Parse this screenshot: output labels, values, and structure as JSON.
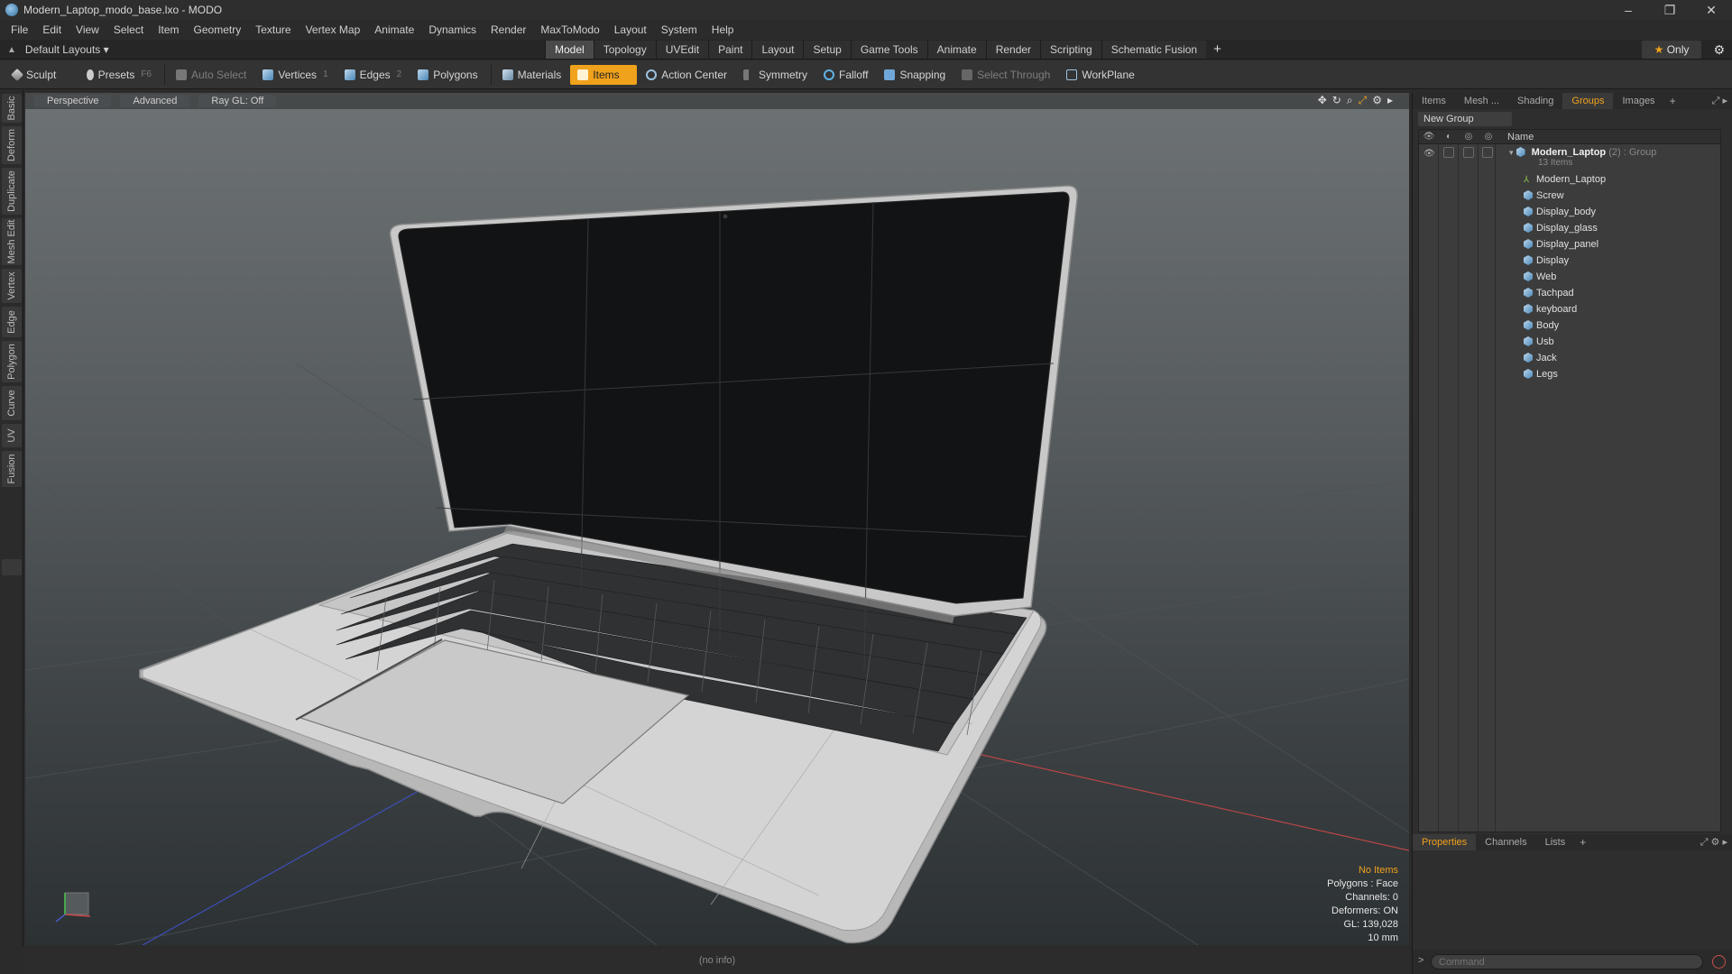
{
  "window": {
    "title": "Modern_Laptop_modo_base.lxo - MODO",
    "min": "–",
    "max": "❐",
    "close": "✕"
  },
  "menu": [
    "File",
    "Edit",
    "View",
    "Select",
    "Item",
    "Geometry",
    "Texture",
    "Vertex Map",
    "Animate",
    "Dynamics",
    "Render",
    "MaxToModo",
    "Layout",
    "System",
    "Help"
  ],
  "layout_bar": {
    "layouts_label": "Default Layouts ▾",
    "tabs": [
      "Model",
      "Topology",
      "UVEdit",
      "Paint",
      "Layout",
      "Setup",
      "Game Tools",
      "Animate",
      "Render",
      "Scripting",
      "Schematic Fusion"
    ],
    "active_tab": "Model",
    "plus": "+",
    "only_label": "Only",
    "gear": "⚙"
  },
  "toolbar": {
    "sculpt": "Sculpt",
    "presets": "Presets",
    "presets_key": "F6",
    "auto_select": "Auto Select",
    "vertices": "Vertices",
    "vertices_count": "1",
    "edges": "Edges",
    "edges_count": "2",
    "polygons": "Polygons",
    "materials": "Materials",
    "items": "Items",
    "action_center": "Action Center",
    "symmetry": "Symmetry",
    "falloff": "Falloff",
    "snapping": "Snapping",
    "select_through": "Select Through",
    "workplane": "WorkPlane"
  },
  "left_tabs": [
    "Basic",
    "Deform",
    "Duplicate",
    "Mesh Edit",
    "Vertex",
    "Edge",
    "Polygon",
    "Curve",
    "UV",
    "Fusion"
  ],
  "viewport": {
    "view_label": "Perspective",
    "shading_label": "Advanced",
    "raygl_label": "Ray GL: Off",
    "hud": {
      "title": "No Items",
      "lines": [
        "Polygons : Face",
        "Channels: 0",
        "Deformers: ON",
        "GL: 139,028",
        "10 mm"
      ]
    },
    "status_info": "(no info)"
  },
  "right_panel": {
    "top_tabs": [
      "Items",
      "Mesh ...",
      "Shading",
      "Groups",
      "Images"
    ],
    "active_top_tab": "Groups",
    "new_group": "New Group",
    "name_header": "Name",
    "group": {
      "name": "Modern_Laptop",
      "count": "(2)",
      "type": ": Group",
      "sub": "13 Items"
    },
    "items": [
      "Modern_Laptop",
      "Screw",
      "Display_body",
      "Display_glass",
      "Display_panel",
      "Display",
      "Web",
      "Tachpad",
      "keyboard",
      "Body",
      "Usb",
      "Jack",
      "Legs"
    ],
    "bottom_tabs": [
      "Properties",
      "Channels",
      "Lists"
    ],
    "active_bottom_tab": "Properties",
    "command_placeholder": "Command"
  },
  "colors": {
    "accent": "#f0a21c",
    "axis_x": "#c84a4a",
    "axis_z": "#4a5ac8"
  }
}
